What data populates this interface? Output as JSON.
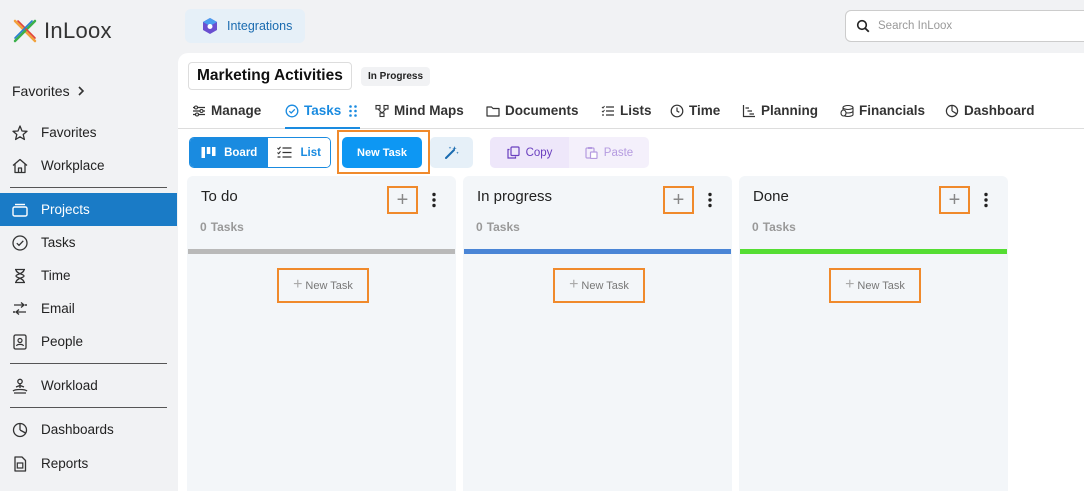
{
  "app": {
    "name": "InLoox"
  },
  "sidebar": {
    "favorites_header": "Favorites",
    "items": [
      {
        "label": "Favorites",
        "icon": "star-icon"
      },
      {
        "label": "Workplace",
        "icon": "home-icon"
      },
      {
        "label": "Projects",
        "icon": "projects-icon",
        "active": true
      },
      {
        "label": "Tasks",
        "icon": "check-circle-icon"
      },
      {
        "label": "Time",
        "icon": "hourglass-icon"
      },
      {
        "label": "Email",
        "icon": "email-icon"
      },
      {
        "label": "People",
        "icon": "contact-icon"
      },
      {
        "label": "Workload",
        "icon": "workload-icon"
      },
      {
        "label": "Dashboards",
        "icon": "pie-chart-icon"
      },
      {
        "label": "Reports",
        "icon": "report-icon"
      }
    ]
  },
  "integrations": {
    "label": "Integrations"
  },
  "search": {
    "placeholder": "Search InLoox"
  },
  "project": {
    "title": "Marketing Activities",
    "status": "In Progress"
  },
  "tabs": [
    {
      "label": "Manage",
      "icon": "sliders-icon"
    },
    {
      "label": "Tasks",
      "icon": "check-circle-icon",
      "active": true
    },
    {
      "label": "Mind Maps",
      "icon": "mindmap-icon"
    },
    {
      "label": "Documents",
      "icon": "folder-icon"
    },
    {
      "label": "Lists",
      "icon": "list-icon"
    },
    {
      "label": "Time",
      "icon": "clock-icon"
    },
    {
      "label": "Planning",
      "icon": "gantt-icon"
    },
    {
      "label": "Financials",
      "icon": "coins-icon"
    },
    {
      "label": "Dashboard",
      "icon": "pie-chart-icon"
    }
  ],
  "toolbar": {
    "board_label": "Board",
    "list_label": "List",
    "new_task_label": "New Task",
    "copy_label": "Copy",
    "paste_label": "Paste"
  },
  "columns": [
    {
      "title": "To do",
      "count": "0",
      "count_label": "Tasks",
      "new_task_label": "New Task",
      "color": "#b9b9b9"
    },
    {
      "title": "In progress",
      "count": "0",
      "count_label": "Tasks",
      "new_task_label": "New Task",
      "color": "#4a85d6"
    },
    {
      "title": "Done",
      "count": "0",
      "count_label": "Tasks",
      "new_task_label": "New Task",
      "color": "#55dd33"
    }
  ],
  "colors": {
    "accent": "#1a8be0",
    "highlight": "#f08a2c",
    "sidebar_active": "#1a7bc6"
  }
}
